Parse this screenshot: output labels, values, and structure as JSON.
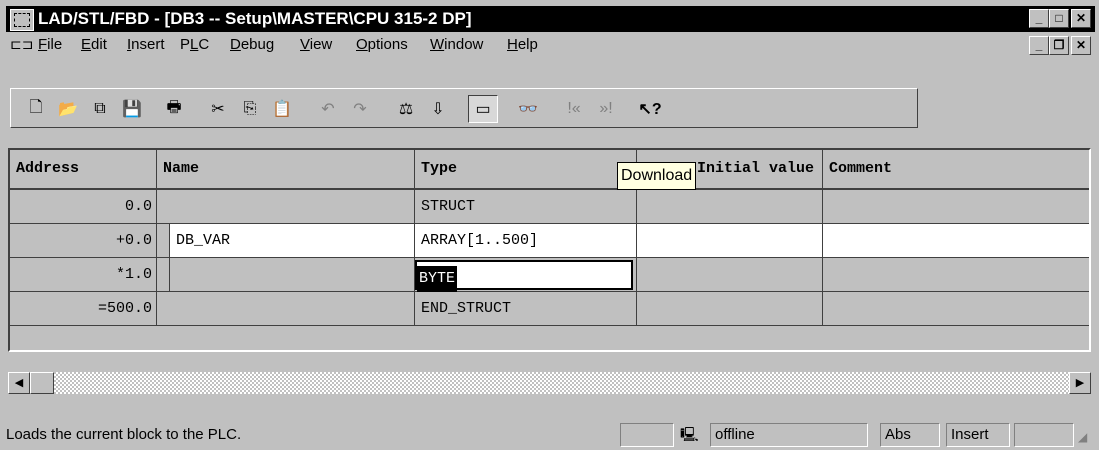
{
  "window": {
    "title": "LAD/STL/FBD  - [DB3 -- Setup\\MASTER\\CPU 315-2 DP]",
    "min_glyph": "_",
    "max_glyph": "□",
    "close_glyph": "✕",
    "doc_restore_glyph": "❐"
  },
  "menu": [
    {
      "pre": "",
      "u": "F",
      "post": "ile"
    },
    {
      "pre": "",
      "u": "E",
      "post": "dit"
    },
    {
      "pre": "",
      "u": "I",
      "post": "nsert"
    },
    {
      "pre": "P",
      "u": "L",
      "post": "C"
    },
    {
      "pre": "",
      "u": "D",
      "post": "ebug"
    },
    {
      "pre": "",
      "u": "V",
      "post": "iew"
    },
    {
      "pre": "",
      "u": "O",
      "post": "ptions"
    },
    {
      "pre": "",
      "u": "W",
      "post": "indow"
    },
    {
      "pre": "",
      "u": "H",
      "post": "elp"
    }
  ],
  "toolbar": {
    "new": "🗋",
    "open": "📂",
    "accessible": "⧉",
    "save": "💾",
    "print": "🖶",
    "cut": "✂",
    "copy": "⎘",
    "paste": "📋",
    "undo": "↶",
    "redo": "↷",
    "compare": "⚖",
    "download": "⇩",
    "monitor": "▭",
    "glasses": "👓",
    "prev": "!«",
    "next": "»!",
    "help": "↖?"
  },
  "table": {
    "headers": [
      "Address",
      "Name",
      "Type",
      "Initial value",
      "Comment"
    ],
    "rows": [
      {
        "address": "0.0",
        "name": "",
        "type": "STRUCT",
        "initial": "",
        "comment": ""
      },
      {
        "address": "+0.0",
        "name": "DB_VAR",
        "type": "ARRAY[1..500]",
        "initial": "",
        "comment": ""
      },
      {
        "address": "*1.0",
        "name": "",
        "type": "BYTE",
        "initial": "",
        "comment": ""
      },
      {
        "address": "=500.0",
        "name": "",
        "type": "END_STRUCT",
        "initial": "",
        "comment": ""
      }
    ]
  },
  "tooltip": "Download",
  "scroll": {
    "left_glyph": "◀",
    "right_glyph": "▶"
  },
  "status": {
    "message": "Loads the current block to the PLC.",
    "connection_icon": "🖳",
    "mode": "offline",
    "abs": "Abs",
    "insert": "Insert"
  }
}
